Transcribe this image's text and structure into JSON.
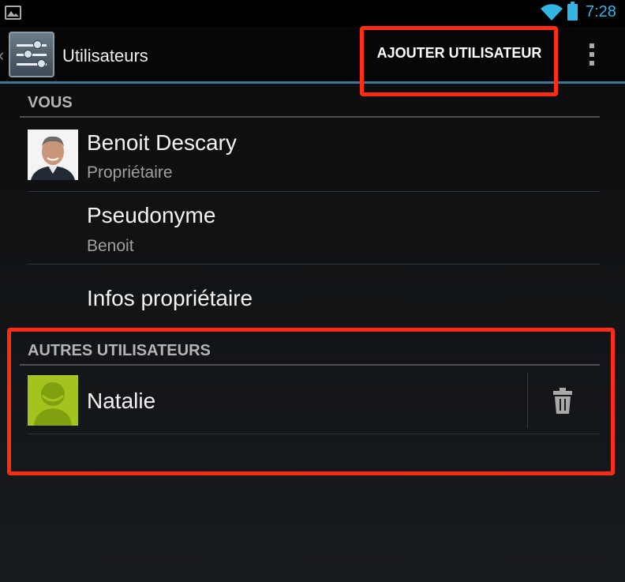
{
  "status_bar": {
    "time": "7:28",
    "icons": [
      "gallery-icon",
      "wifi-icon",
      "battery-icon"
    ],
    "accent_color": "#33b5e5"
  },
  "action_bar": {
    "title": "Utilisateurs",
    "add_user_label": "AJOUTER UTILISATEUR",
    "icons": [
      "settings-icon",
      "overflow-menu-icon"
    ]
  },
  "sections": {
    "you": {
      "header": "VOUS",
      "owner": {
        "name": "Benoit Descary",
        "role": "Propriétaire"
      },
      "nickname": {
        "label": "Pseudonyme",
        "value": "Benoit"
      },
      "owner_info": {
        "label": "Infos propriétaire"
      }
    },
    "other_users": {
      "header": "AUTRES UTILISATEURS",
      "users": [
        {
          "name": "Natalie"
        }
      ]
    }
  },
  "colors": {
    "highlight": "#ff2d14",
    "action_bar_underline": "#3e7797",
    "guest_avatar": "#a3c41f"
  }
}
